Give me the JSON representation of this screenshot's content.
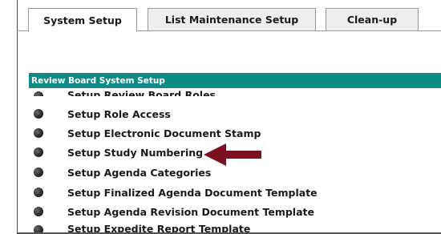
{
  "tabs": [
    {
      "label": "System Setup",
      "active": true
    },
    {
      "label": "List Maintenance Setup",
      "active": false
    },
    {
      "label": "Clean-up",
      "active": false
    }
  ],
  "section": {
    "title": "Review Board System Setup"
  },
  "items": [
    {
      "label": "Setup Review Board Roles"
    },
    {
      "label": "Setup Role Access"
    },
    {
      "label": "Setup Electronic Document Stamp"
    },
    {
      "label": "Setup Study Numbering"
    },
    {
      "label": "Setup Agenda Categories"
    },
    {
      "label": "Setup Finalized Agenda Document Template"
    },
    {
      "label": "Setup Agenda Revision Document Template"
    },
    {
      "label": "Setup Expedite Report Template"
    }
  ],
  "annotation": {
    "type": "arrow-left",
    "color": "#7a1020",
    "points_to_item": "Setup Study Numbering"
  },
  "colors": {
    "section_header": "#0e8b84",
    "arrow": "#7a1020"
  }
}
